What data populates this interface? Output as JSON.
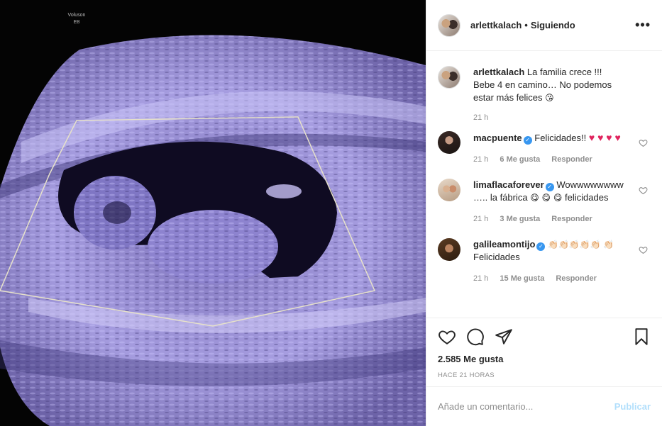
{
  "media": {
    "overlay_text_line1": "Voluson",
    "overlay_text_line2": "E8"
  },
  "header": {
    "username": "arlettkalach",
    "separator": "•",
    "follow_status": "Siguiendo",
    "more_label": "•••"
  },
  "caption": {
    "username": "arlettkalach",
    "text": "La familia crece !!! Bebe 4 en camino… No podemos estar más felices",
    "emoji": "😘",
    "time": "21 h"
  },
  "comments": [
    {
      "username": "macpuente",
      "verified": true,
      "text": "Felicidades!!",
      "emoji": "♥ ♥ ♥ ♥",
      "time": "21 h",
      "likes": "6 Me gusta",
      "reply": "Responder"
    },
    {
      "username": "limaflacaforever",
      "verified": true,
      "text": "Wowwwwwwww ….. la fábrica",
      "emoji": "😋 😋 😋",
      "text2": "felicidades",
      "time": "21 h",
      "likes": "3 Me gusta",
      "reply": "Responder"
    },
    {
      "username": "galileamontijo",
      "verified": true,
      "emoji": "👏🏻👏🏻👏🏻👏🏻👏🏻",
      "emoji2": "👏🏻",
      "text": "Felicidades",
      "time": "21 h",
      "likes": "15 Me gusta",
      "reply": "Responder"
    }
  ],
  "stats": {
    "likes": "2.585 Me gusta",
    "ago": "HACE 21 HORAS"
  },
  "add_comment": {
    "placeholder": "Añade un comentario...",
    "post_label": "Publicar"
  },
  "icons": {
    "like": "heart-icon",
    "comment": "comment-icon",
    "share": "paper-plane-icon",
    "save": "bookmark-icon"
  },
  "colors": {
    "verified": "#3897f0",
    "post_button_disabled": "#b2dffc",
    "ultrasound_tint": "#9a8fd8"
  }
}
